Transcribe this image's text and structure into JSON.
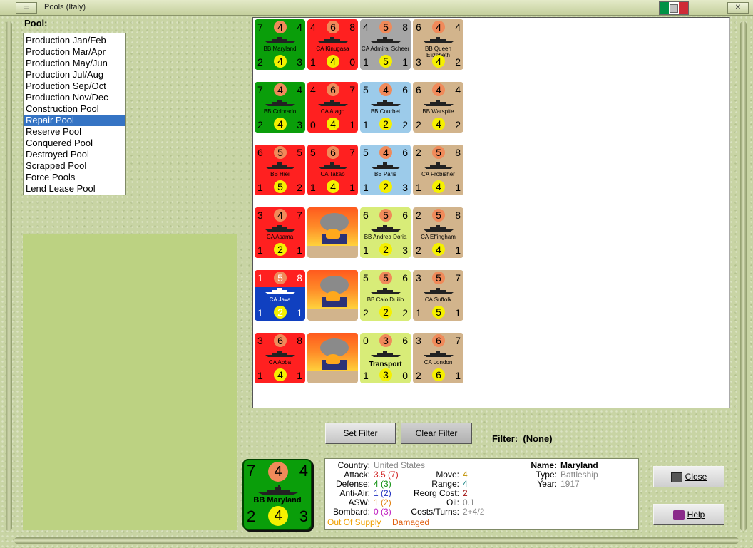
{
  "window": {
    "title": "Pools (Italy)",
    "close_glyph": "✕"
  },
  "pool_label": "Pool:",
  "pools": [
    "Production Jan/Feb",
    "Production Mar/Apr",
    "Production May/Jun",
    "Production Jul/Aug",
    "Production Sep/Oct",
    "Production Nov/Dec",
    "Construction Pool",
    "Repair Pool",
    "Reserve Pool",
    "Conquered Pool",
    "Destroyed Pool",
    "Scrapped Pool",
    "Force Pools",
    "Lend Lease Pool"
  ],
  "selected_pool": "Repair Pool",
  "colors": {
    "usa_green": "#0a9e0a",
    "japan_red": "#ff2020",
    "germany_grey": "#a6a6a6",
    "uk_tan": "#d2b48c",
    "france_blue": "#9ccbea",
    "italy_lime": "#d8ec78",
    "netherlands": "#ff2020/#1040c0"
  },
  "counters": [
    [
      {
        "tl": "7",
        "att": "4",
        "tr": "4",
        "name": "BB Maryland",
        "bl": "2",
        "mv": "4",
        "br": "3",
        "bg": "#0a9e0a"
      },
      {
        "tl": "4",
        "att": "6",
        "tr": "8",
        "name": "CA Kinugasa",
        "bl": "1",
        "mv": "4",
        "br": "0",
        "bg": "#ff2020"
      },
      {
        "tl": "4",
        "att": "5",
        "tr": "8",
        "name": "CA Admiral Scheer",
        "bl": "1",
        "mv": "5",
        "br": "1",
        "bg": "#a6a6a6"
      },
      {
        "tl": "6",
        "att": "4",
        "tr": "4",
        "name": "BB Queen Elizabeth",
        "bl": "3",
        "mv": "4",
        "br": "2",
        "bg": "#d2b48c"
      }
    ],
    [
      {
        "tl": "7",
        "att": "4",
        "tr": "4",
        "name": "BB Colorado",
        "bl": "2",
        "mv": "4",
        "br": "3",
        "bg": "#0a9e0a"
      },
      {
        "tl": "4",
        "att": "6",
        "tr": "7",
        "name": "CA Atago",
        "bl": "0",
        "mv": "4",
        "br": "1",
        "bg": "#ff2020"
      },
      {
        "tl": "5",
        "att": "4",
        "tr": "6",
        "name": "BB Courbet",
        "bl": "1",
        "mv": "2",
        "br": "2",
        "bg": "#9ccbea"
      },
      {
        "tl": "6",
        "att": "4",
        "tr": "4",
        "name": "BB Warspite",
        "bl": "2",
        "mv": "4",
        "br": "2",
        "bg": "#d2b48c"
      }
    ],
    [
      {
        "tl": "6",
        "att": "5",
        "tr": "5",
        "name": "BB Hiei",
        "bl": "1",
        "mv": "5",
        "br": "2",
        "bg": "#ff2020"
      },
      {
        "tl": "5",
        "att": "6",
        "tr": "7",
        "name": "CA Takao",
        "bl": "1",
        "mv": "4",
        "br": "1",
        "bg": "#ff2020"
      },
      {
        "tl": "5",
        "att": "4",
        "tr": "6",
        "name": "BB Paris",
        "bl": "1",
        "mv": "2",
        "br": "3",
        "bg": "#9ccbea"
      },
      {
        "tl": "2",
        "att": "5",
        "tr": "8",
        "name": "CA Frobisher",
        "bl": "1",
        "mv": "4",
        "br": "1",
        "bg": "#d2b48c"
      }
    ],
    [
      {
        "tl": "3",
        "att": "4",
        "tr": "7",
        "name": "CA Asama",
        "bl": "1",
        "mv": "2",
        "br": "1",
        "bg": "#ff2020"
      },
      {
        "fire": true
      },
      {
        "tl": "6",
        "att": "5",
        "tr": "6",
        "name": "BB Andrea Doria",
        "bl": "1",
        "mv": "2",
        "br": "3",
        "bg": "#d8ec78"
      },
      {
        "tl": "2",
        "att": "5",
        "tr": "8",
        "name": "CA Effingham",
        "bl": "2",
        "mv": "4",
        "br": "1",
        "bg": "#d2b48c"
      }
    ],
    [
      {
        "tl": "1",
        "att": "5",
        "tr": "8",
        "name": "CA Java",
        "bl": "1",
        "mv": "2",
        "br": "1",
        "bg": "split",
        "fg": "#fff"
      },
      {
        "fire": true
      },
      {
        "tl": "5",
        "att": "5",
        "tr": "6",
        "name": "BB Caio Duilio",
        "bl": "2",
        "mv": "2",
        "br": "2",
        "bg": "#d8ec78"
      },
      {
        "tl": "3",
        "att": "5",
        "tr": "7",
        "name": "CA Suffolk",
        "bl": "1",
        "mv": "5",
        "br": "1",
        "bg": "#d2b48c"
      }
    ],
    [
      {
        "tl": "3",
        "att": "6",
        "tr": "8",
        "name": "CA Abba",
        "bl": "1",
        "mv": "4",
        "br": "1",
        "bg": "#ff2020"
      },
      {
        "fire": true
      },
      {
        "tl": "0",
        "att": "3",
        "tr": "6",
        "name": "Transport",
        "bl": "1",
        "mv": "3",
        "br": "0",
        "bg": "#d8ec78",
        "big": true
      },
      {
        "tl": "3",
        "att": "6",
        "tr": "7",
        "name": "CA London",
        "bl": "2",
        "mv": "6",
        "br": "1",
        "bg": "#d2b48c"
      }
    ]
  ],
  "filter": {
    "set_label": "Set Filter",
    "clear_label": "Clear Filter",
    "label": "Filter:",
    "value": "(None)"
  },
  "selected_unit": {
    "tl": "7",
    "att": "4",
    "tr": "4",
    "name": "BB Maryland",
    "bl": "2",
    "mv": "4",
    "br": "3",
    "country_label": "Country:",
    "country": "United States",
    "attack_label": "Attack:",
    "attack": "3.5",
    "attack_alt": "(7)",
    "defense_label": "Defense:",
    "defense": "4",
    "defense_alt": "(3)",
    "antiair_label": "Anti-Air:",
    "antiair": "1",
    "antiair_alt": "(2)",
    "asw_label": "ASW:",
    "asw": "1",
    "asw_alt": "(2)",
    "bombard_label": "Bombard:",
    "bombard": "0",
    "bombard_alt": "(3)",
    "move_label": "Move:",
    "move": "4",
    "range_label": "Range:",
    "range": "4",
    "reorg_label": "Reorg Cost:",
    "reorg": "2",
    "oil_label": "Oil:",
    "oil": "0.1",
    "cost_label": "Costs/Turns:",
    "cost": "2+4/2",
    "name_label": "Name:",
    "unit_name": "Maryland",
    "type_label": "Type:",
    "type": "Battleship",
    "year_label": "Year:",
    "year": "1917",
    "status1": "Out Of Supply",
    "status2": "Damaged"
  },
  "buttons": {
    "close": "Close",
    "help": "Help"
  }
}
